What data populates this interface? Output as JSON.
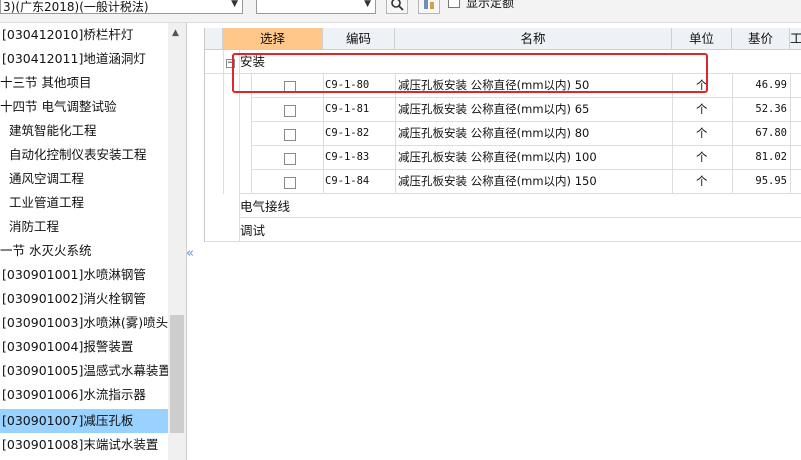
{
  "toolbar": {
    "library_select_value": "3)(广东2018)(一般计税法)",
    "search_value": "",
    "show_fixed_label": "显示定额"
  },
  "tree": {
    "items": [
      {
        "label": "[030412010]桥栏杆灯",
        "selected": false
      },
      {
        "label": "[030412011]地道涵洞灯",
        "selected": false
      },
      {
        "label": "十三节  其他项目",
        "selected": false
      },
      {
        "label": "十四节 电气调整试验",
        "selected": false
      },
      {
        "label": "建筑智能化工程",
        "selected": false
      },
      {
        "label": "自动化控制仪表安装工程",
        "selected": false
      },
      {
        "label": "通风空调工程",
        "selected": false
      },
      {
        "label": "工业管道工程",
        "selected": false
      },
      {
        "label": "消防工程",
        "selected": false
      },
      {
        "label": "一节  水灭火系统",
        "selected": false
      },
      {
        "label": "[030901001]水喷淋钢管",
        "selected": false
      },
      {
        "label": "[030901002]消火栓钢管",
        "selected": false
      },
      {
        "label": "[030901003]水喷淋(雾)喷头",
        "selected": false
      },
      {
        "label": "[030901004]报警装置",
        "selected": false
      },
      {
        "label": "[030901005]温感式水幕装置",
        "selected": false
      },
      {
        "label": "[030901006]水流指示器",
        "selected": false
      },
      {
        "label": "[030901007]减压孔板",
        "selected": true
      },
      {
        "label": "[030901008]末端试水装置",
        "selected": false
      }
    ]
  },
  "grid": {
    "columns": {
      "select": "选择",
      "code": "编码",
      "name": "名称",
      "unit": "单位",
      "price": "基价",
      "extra": "工"
    },
    "group_install": "安装",
    "rows": [
      {
        "code": "C9-1-80",
        "name": "减压孔板安装 公称直径(mm以内) 50",
        "unit": "个",
        "price": "46.99"
      },
      {
        "code": "C9-1-81",
        "name": "减压孔板安装 公称直径(mm以内) 65",
        "unit": "个",
        "price": "52.36"
      },
      {
        "code": "C9-1-82",
        "name": "减压孔板安装 公称直径(mm以内) 80",
        "unit": "个",
        "price": "67.80"
      },
      {
        "code": "C9-1-83",
        "name": "减压孔板安装 公称直径(mm以内) 100",
        "unit": "个",
        "price": "81.02"
      },
      {
        "code": "C9-1-84",
        "name": "减压孔板安装 公称直径(mm以内) 150",
        "unit": "个",
        "price": "95.95"
      }
    ],
    "group_wiring": "电气接线",
    "group_debug": "调试"
  },
  "colors": {
    "selected_tree_bg": "#99d1ff",
    "select_header_bg": "#ffc88a",
    "highlight_border": "#e0262b"
  }
}
